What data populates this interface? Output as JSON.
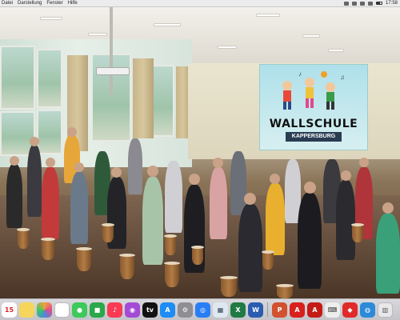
{
  "menubar": {
    "items": [
      "Datei",
      "Darstellung",
      "Fenster",
      "Hilfe"
    ],
    "clock": "17:58"
  },
  "video": {
    "banner_title": "WALLSCHULE",
    "banner_subtitle": "KAPPERSBURG"
  },
  "dock": {
    "calendar_day": "15",
    "apps": [
      {
        "name": "calendar",
        "color": "#ffffff"
      },
      {
        "name": "notes",
        "color": "#f5d65a"
      },
      {
        "name": "photos",
        "color": "#f0a040"
      },
      {
        "name": "freeform",
        "color": "#ffffff"
      },
      {
        "name": "messages",
        "color": "#3ec95a"
      },
      {
        "name": "facetime",
        "color": "#2aa84a"
      },
      {
        "name": "music",
        "color": "#fa3a55"
      },
      {
        "name": "podcasts",
        "color": "#a44bd6"
      },
      {
        "name": "tv",
        "color": "#111111"
      },
      {
        "name": "app-store",
        "color": "#1d8cf5"
      },
      {
        "name": "settings",
        "color": "#8e8e93"
      },
      {
        "name": "safari",
        "color": "#2a7ef5"
      },
      {
        "name": "preview",
        "color": "#dfe8f0"
      },
      {
        "name": "excel",
        "color": "#1f7a43"
      },
      {
        "name": "word",
        "color": "#2a5cb0"
      },
      {
        "name": "powerpoint",
        "color": "#d2512f"
      },
      {
        "name": "acrobat",
        "color": "#d8201c"
      },
      {
        "name": "acrobat-reader",
        "color": "#c41b17"
      },
      {
        "name": "keyboard",
        "color": "#eeeeee"
      },
      {
        "name": "shield-app",
        "color": "#e02a2a"
      },
      {
        "name": "globe-app",
        "color": "#2c8ad8"
      },
      {
        "name": "trash",
        "color": "#e8e8ea"
      }
    ]
  }
}
